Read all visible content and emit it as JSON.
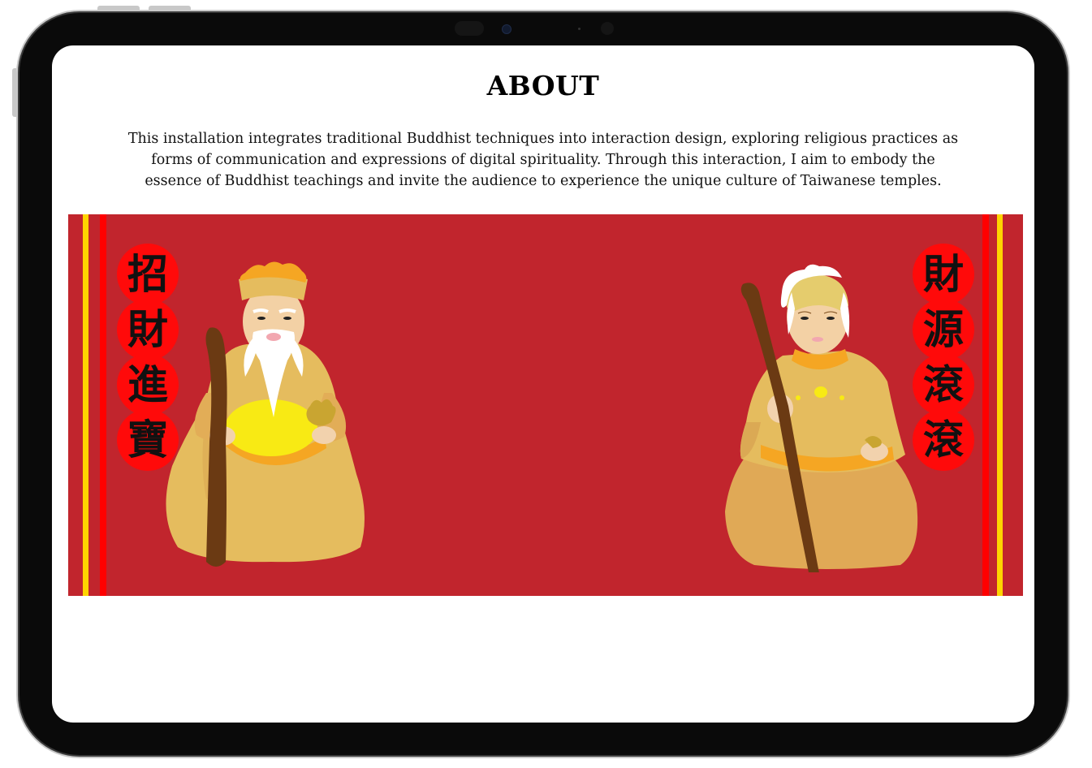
{
  "about": {
    "title": "ABOUT",
    "description": "This installation integrates traditional Buddhist techniques into interaction design, exploring religious practices as forms of communication and expressions of digital spirituality. Through this interaction, I aim to embody the essence of Buddhist teachings and invite the audience to experience the unique culture of Taiwanese temples."
  },
  "banner": {
    "left_couplet": [
      "招",
      "財",
      "進",
      "寶"
    ],
    "right_couplet": [
      "財",
      "源",
      "滾",
      "滾"
    ]
  },
  "colors": {
    "banner_red": "#c1252d",
    "stripe_red": "#ff0000",
    "stripe_yellow": "#ffd400",
    "circle_red": "#ff0a0a",
    "robe": "#e5bc5e",
    "staff": "#6b3a13"
  }
}
